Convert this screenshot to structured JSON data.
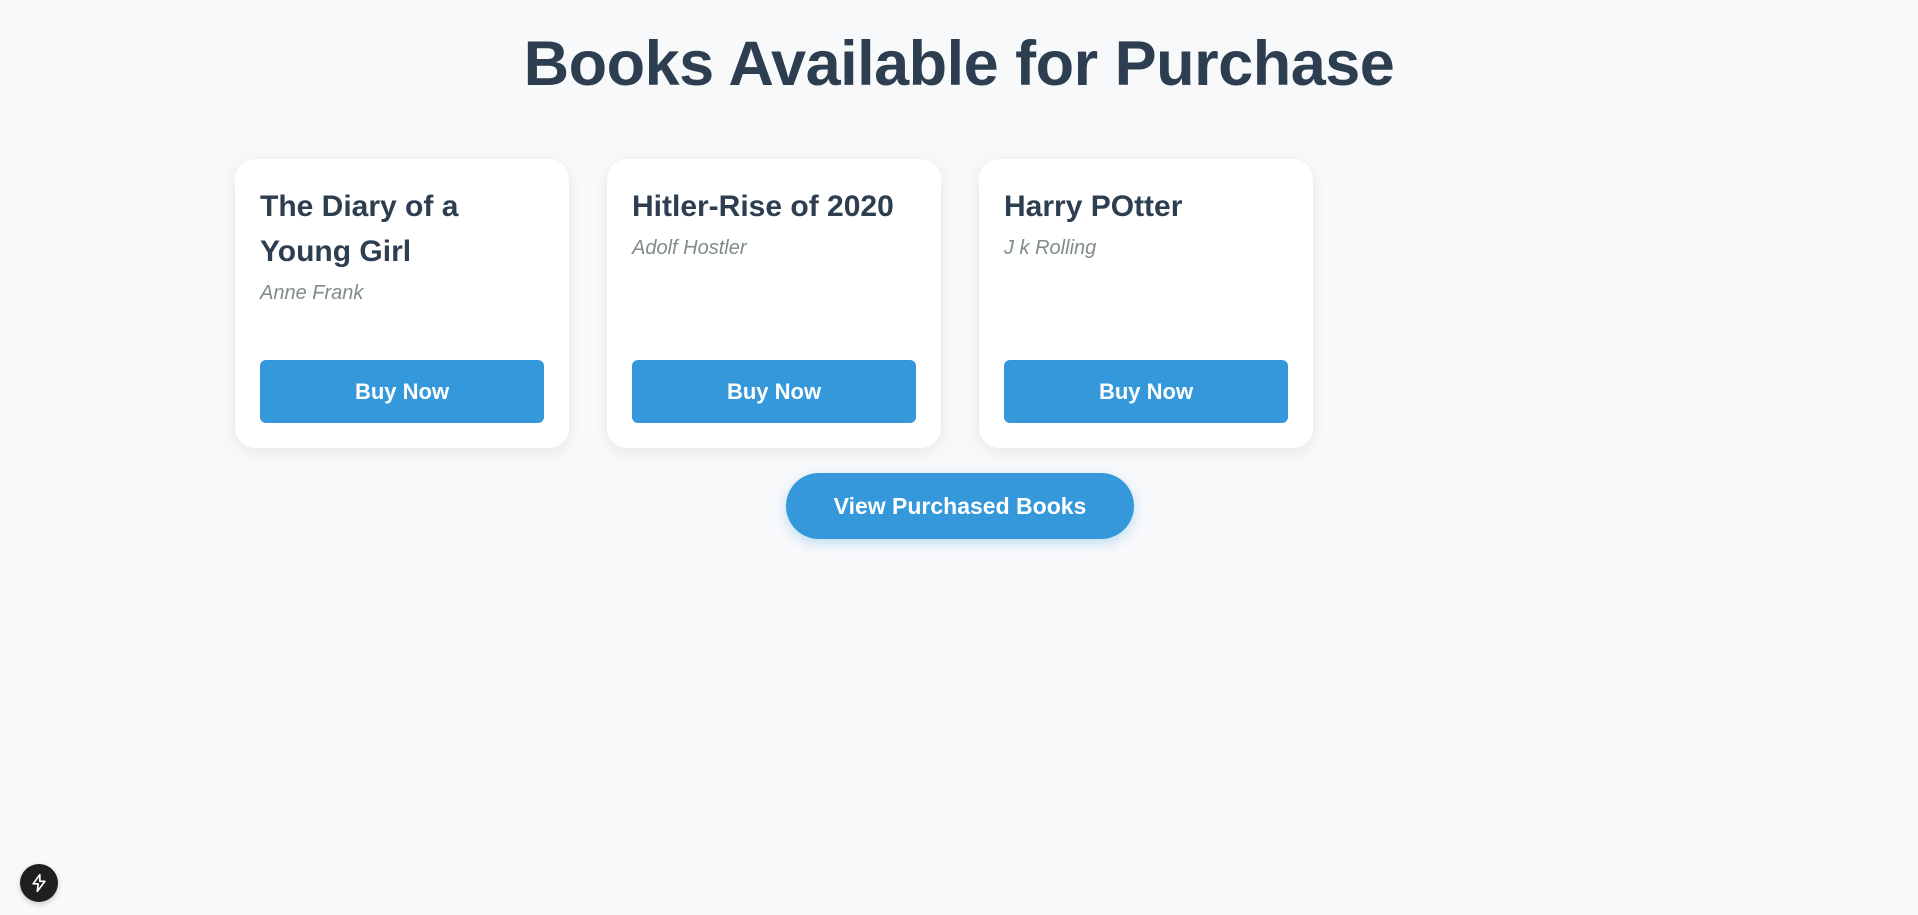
{
  "page": {
    "title": "Books Available for Purchase"
  },
  "books": [
    {
      "title": "The Diary of a Young Girl",
      "author": "Anne Frank",
      "button": "Buy Now"
    },
    {
      "title": "Hitler-Rise of 2020",
      "author": "Adolf Hostler",
      "button": "Buy Now"
    },
    {
      "title": "Harry POtter",
      "author": "J k Rolling",
      "button": "Buy Now"
    }
  ],
  "actions": {
    "view_purchased": "View Purchased Books"
  },
  "icons": {
    "dev_badge": "lightning-icon"
  },
  "colors": {
    "accent": "#3498db",
    "heading": "#2c3e50",
    "muted": "#7f8c8d",
    "background": "#f8f9fb"
  }
}
